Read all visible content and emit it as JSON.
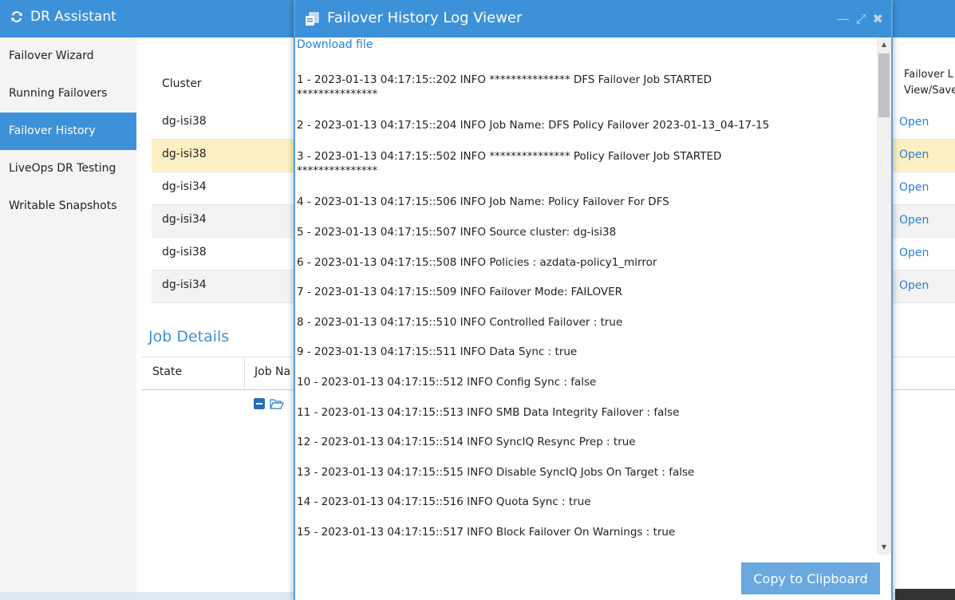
{
  "app": {
    "title": "DR Assistant"
  },
  "sidebar": {
    "items": [
      {
        "label": "Failover Wizard"
      },
      {
        "label": "Running Failovers"
      },
      {
        "label": "Failover History"
      },
      {
        "label": "LiveOps DR Testing"
      },
      {
        "label": "Writable Snapshots"
      }
    ],
    "active_index": 2
  },
  "history_table": {
    "columns": {
      "cluster": "Cluster",
      "failover_log_line1": "Failover L",
      "failover_log_line2": "View/Save"
    },
    "rows": [
      {
        "cluster": "dg-isi38",
        "log": "Open"
      },
      {
        "cluster": "dg-isi38",
        "log": "Open"
      },
      {
        "cluster": "dg-isi34",
        "log": "Open"
      },
      {
        "cluster": "dg-isi34",
        "log": "Open"
      },
      {
        "cluster": "dg-isi38",
        "log": "Open"
      },
      {
        "cluster": "dg-isi34",
        "log": "Open"
      }
    ],
    "selected_index": 1
  },
  "job_details": {
    "title": "Job Details",
    "columns": {
      "state": "State",
      "job_name": "Job Na"
    }
  },
  "modal": {
    "title": "Failover History Log Viewer",
    "download_link": "Download file",
    "log_lines": [
      "1 - 2023-01-13 04:17:15::202 INFO *************** DFS Failover Job STARTED\n***************",
      "2 - 2023-01-13 04:17:15::204 INFO Job Name: DFS Policy Failover 2023-01-13_04-17-15",
      "3 - 2023-01-13 04:17:15::502 INFO *************** Policy Failover Job STARTED\n***************",
      "4 - 2023-01-13 04:17:15::506 INFO Job Name: Policy Failover For DFS",
      "5 - 2023-01-13 04:17:15::507 INFO Source cluster: dg-isi38",
      "6 - 2023-01-13 04:17:15::508 INFO Policies : azdata-policy1_mirror",
      "7 - 2023-01-13 04:17:15::509 INFO Failover Mode: FAILOVER",
      "8 - 2023-01-13 04:17:15::510 INFO Controlled Failover : true",
      "9 - 2023-01-13 04:17:15::511 INFO Data Sync : true",
      "10 - 2023-01-13 04:17:15::512 INFO Config Sync : false",
      "11 - 2023-01-13 04:17:15::513 INFO SMB Data Integrity Failover : false",
      "12 - 2023-01-13 04:17:15::514 INFO SyncIQ Resync Prep : true",
      "13 - 2023-01-13 04:17:15::515 INFO Disable SyncIQ Jobs On Target : false",
      "14 - 2023-01-13 04:17:15::516 INFO Quota Sync : true",
      "15 - 2023-01-13 04:17:15::517 INFO Block Failover On Warnings : true"
    ],
    "copy_button": "Copy to Clipboard"
  },
  "colors": {
    "primary": "#3d91d8",
    "link": "#2a7fd4",
    "selected_row": "#fdf0c2",
    "button": "#6aa8e0"
  }
}
